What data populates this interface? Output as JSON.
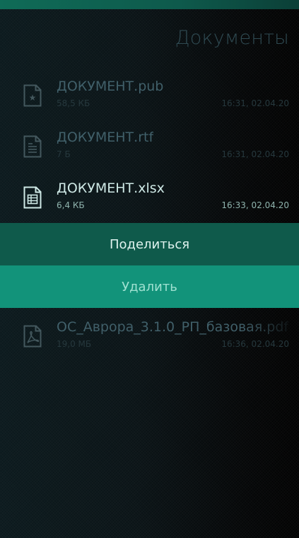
{
  "header": {
    "title": "Документы"
  },
  "files": [
    {
      "name": "ДОКУМЕНТ.pub",
      "size": "58,5 КБ",
      "date": "16:31, 02.04.20",
      "icon": "publisher-file-icon"
    },
    {
      "name": "ДОКУМЕНТ.rtf",
      "size": "7 Б",
      "date": "16:31, 02.04.20",
      "icon": "text-file-icon"
    },
    {
      "name": "ДОКУМЕНТ.xlsx",
      "size": "6,4 КБ",
      "date": "16:33, 02.04.20",
      "icon": "spreadsheet-file-icon"
    },
    {
      "name": "ОС_Аврора_3.1.0_РП_базовая.pdf",
      "size": "19,0 МБ",
      "date": "16:36, 02.04.20",
      "icon": "pdf-file-icon"
    }
  ],
  "context_menu": {
    "share_label": "Поделиться",
    "delete_label": "Удалить"
  },
  "colors": {
    "accent": "#12937a",
    "accent_dark": "#0f5a4b",
    "highlight_text": "#cfe9e6"
  }
}
